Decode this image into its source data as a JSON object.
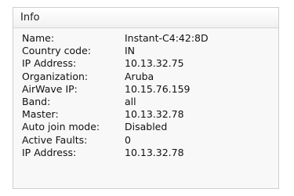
{
  "panel": {
    "title": "Info",
    "rows": [
      {
        "label": "Name:",
        "value": "Instant-C4:42:8D"
      },
      {
        "label": "Country code:",
        "value": "IN"
      },
      {
        "label": "IP Address:",
        "value": "10.13.32.75"
      },
      {
        "label": "Organization:",
        "value": "Aruba"
      },
      {
        "label": "AirWave IP:",
        "value": "10.15.76.159"
      },
      {
        "label": "Band:",
        "value": "all"
      },
      {
        "label": "Master:",
        "value": "10.13.32.78"
      },
      {
        "label": "Auto join mode:",
        "value": "Disabled"
      },
      {
        "label": "Active Faults:",
        "value": "0"
      },
      {
        "label": "IP Address:",
        "value": "10.13.32.78"
      }
    ]
  }
}
